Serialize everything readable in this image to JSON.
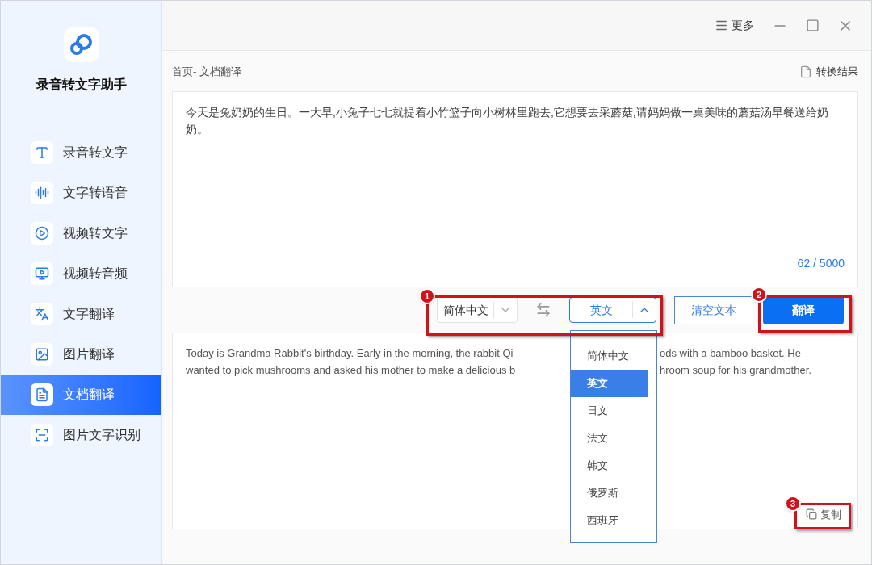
{
  "app": {
    "title": "录音转文字助手"
  },
  "nav": [
    {
      "label": "录音转文字",
      "selected": false
    },
    {
      "label": "文字转语音",
      "selected": false
    },
    {
      "label": "视频转文字",
      "selected": false
    },
    {
      "label": "视频转音频",
      "selected": false
    },
    {
      "label": "文字翻译",
      "selected": false
    },
    {
      "label": "图片翻译",
      "selected": false
    },
    {
      "label": "文档翻译",
      "selected": true
    },
    {
      "label": "图片文字识别",
      "selected": false
    }
  ],
  "titlebar": {
    "more": "更多"
  },
  "breadcrumb": "首页- 文档翻译",
  "result_link": "转换结果",
  "input": {
    "value": "今天是兔奶奶的生日。一大早,小兔子七七就提着小竹篮子向小树林里跑去,它想要去采蘑菇,请妈妈做一桌美味的蘑菇汤早餐送给奶奶。",
    "counter": "62 / 5000"
  },
  "source_lang": {
    "value": "简体中文",
    "expanded": false
  },
  "target_lang": {
    "value": "英文",
    "expanded": true,
    "options": [
      {
        "label": "简体中文",
        "selected": false
      },
      {
        "label": "英文",
        "selected": true
      },
      {
        "label": "日文",
        "selected": false
      },
      {
        "label": "法文",
        "selected": false
      },
      {
        "label": "韩文",
        "selected": false
      },
      {
        "label": "俄罗斯",
        "selected": false
      },
      {
        "label": "西班牙",
        "selected": false
      }
    ]
  },
  "clear_button": "清空文本",
  "translate_button": "翻译",
  "output": {
    "lines": [
      {
        "left": "Today is Grandma Rabbit's birthday. Early in the morning, the rabbit Qi",
        "right": "ods with a bamboo basket. He"
      },
      {
        "left": "wanted to pick mushrooms and asked his mother to make a delicious b",
        "right": "hroom soup for his grandmother."
      }
    ]
  },
  "copy_button": "复制",
  "callouts": [
    {
      "number": "1"
    },
    {
      "number": "2"
    },
    {
      "number": "3"
    }
  ]
}
